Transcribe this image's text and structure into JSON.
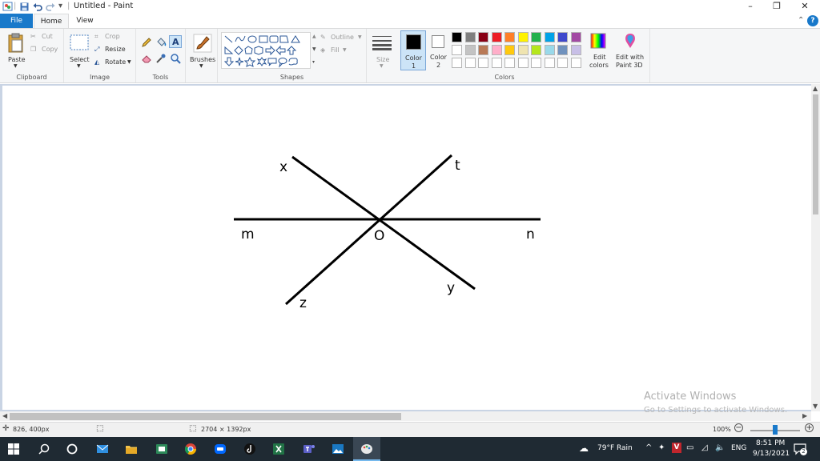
{
  "window": {
    "title": "Untitled - Paint",
    "minimize_glyph": "–",
    "maximize_glyph": "❐",
    "close_glyph": "✕"
  },
  "quick_access": {
    "app_icon": "paint-icon",
    "save_icon": "save-icon",
    "undo_icon": "undo-icon",
    "redo_icon": "redo-icon",
    "customize_glyph": "▾"
  },
  "tabs": {
    "file": "File",
    "home": "Home",
    "view": "View",
    "collapse_glyph": "⌃",
    "help_glyph": "?"
  },
  "ribbon": {
    "clipboard": {
      "label": "Clipboard",
      "paste": "Paste",
      "cut": "Cut",
      "copy": "Copy"
    },
    "image": {
      "label": "Image",
      "select": "Select",
      "crop": "Crop",
      "resize": "Resize",
      "rotate": "Rotate"
    },
    "tools": {
      "label": "Tools"
    },
    "brushes": {
      "label": "Brushes"
    },
    "shapes": {
      "label": "Shapes",
      "outline": "Outline",
      "fill": "Fill"
    },
    "size": {
      "label": "Size"
    },
    "colors": {
      "label": "Colors",
      "color1": "Color",
      "color1_num": "1",
      "color2": "Color",
      "color2_num": "2",
      "color1_value": "#000000",
      "color2_value": "#ffffff",
      "edit_colors_line1": "Edit",
      "edit_colors_line2": "colors",
      "paint3d_line1": "Edit with",
      "paint3d_line2": "Paint 3D",
      "palette_row1": [
        "#000000",
        "#7f7f7f",
        "#880015",
        "#ed1c24",
        "#ff7f27",
        "#fff200",
        "#22b14c",
        "#00a2e8",
        "#3f48cc",
        "#a349a4"
      ],
      "palette_row2": [
        "#ffffff",
        "#c3c3c3",
        "#b97a57",
        "#ffaec9",
        "#ffc90e",
        "#efe4b0",
        "#b5e61d",
        "#99d9ea",
        "#7092be",
        "#c8bfe7"
      ],
      "palette_row3": [
        "#ffffff",
        "#ffffff",
        "#ffffff",
        "#ffffff",
        "#ffffff",
        "#ffffff",
        "#ffffff",
        "#ffffff",
        "#ffffff",
        "#ffffff"
      ]
    }
  },
  "drawing": {
    "labels": {
      "x": "x",
      "t": "t",
      "m": "m",
      "O": "O",
      "n": "n",
      "y": "y",
      "z": "z"
    }
  },
  "status": {
    "cursor_pos": "826, 400px",
    "image_size": "2704 × 1392px",
    "zoom": "100%",
    "zoom_minus": "−",
    "zoom_plus": "+"
  },
  "activation": {
    "line1": "Activate Windows",
    "line2": "Go to Settings to activate Windows."
  },
  "taskbar": {
    "weather": "79°F  Rain",
    "language": "ENG",
    "time": "8:51 PM",
    "date": "9/13/2021",
    "notification_count": "2",
    "tray_v": "V"
  }
}
